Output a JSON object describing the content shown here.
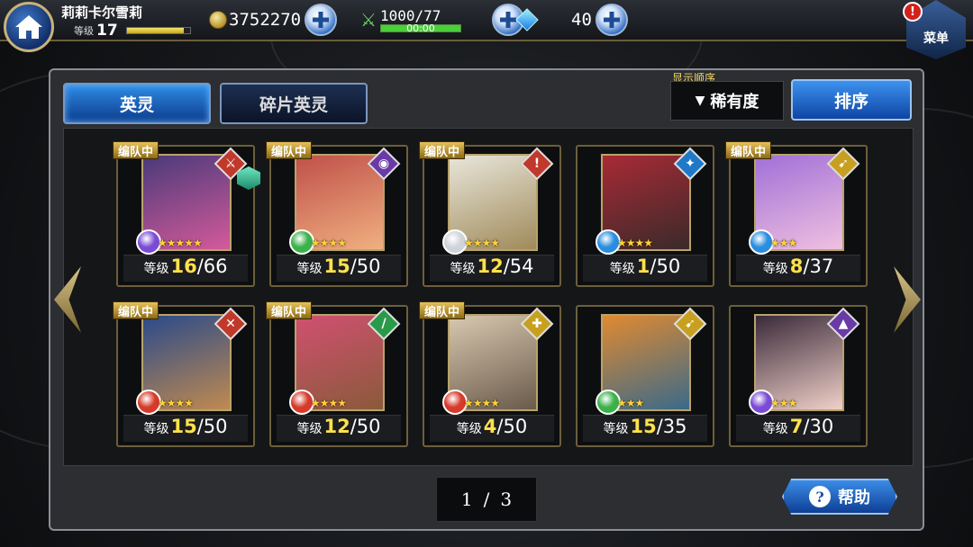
{
  "player": {
    "name": "莉莉卡尔雪莉",
    "level_label": "等级",
    "level": "17",
    "exp_fraction": 0.9
  },
  "resources": {
    "coins": "3752270",
    "stamina": "1000/77",
    "stamina_timer": "00:00",
    "stamina_fraction": 1.0,
    "gems": "40"
  },
  "menu": {
    "label": "菜单",
    "alert": "!"
  },
  "tabs": [
    {
      "label": "英灵"
    },
    {
      "label": "碎片英灵"
    }
  ],
  "sort": {
    "caption": "显示顺序",
    "selected": "稀有度",
    "button_label": "排序"
  },
  "cards": [
    {
      "badge": "编队中",
      "class_glyph": "⚔",
      "class_color": "#c0392b",
      "element_color": "#7b4bd6",
      "stars": 5,
      "level_label": "等级",
      "level": "16",
      "max_level": "66",
      "portrait_colors": [
        "#4a3a7a",
        "#d45a9a"
      ],
      "extra_icon": true
    },
    {
      "badge": "编队中",
      "class_glyph": "◉",
      "class_color": "#6a3aa6",
      "element_color": "#3bb14a",
      "stars": 4,
      "level_label": "等级",
      "level": "15",
      "max_level": "50",
      "portrait_colors": [
        "#c0504a",
        "#f0b080"
      ],
      "extra_icon": false
    },
    {
      "badge": "编队中",
      "class_glyph": "!",
      "class_color": "#c0392b",
      "element_color": "#cfd4da",
      "stars": 4,
      "level_label": "等级",
      "level": "12",
      "max_level": "54",
      "portrait_colors": [
        "#e8e6da",
        "#a08a5a"
      ],
      "extra_icon": false
    },
    {
      "badge": "",
      "class_glyph": "✦",
      "class_color": "#1f78c8",
      "element_color": "#2a8de0",
      "stars": 4,
      "level_label": "等级",
      "level": "1",
      "max_level": "50",
      "portrait_colors": [
        "#a82a35",
        "#3a2a2a"
      ],
      "extra_icon": false
    },
    {
      "badge": "编队中",
      "class_glyph": "➹",
      "class_color": "#c8a020",
      "element_color": "#2a8de0",
      "stars": 3,
      "level_label": "等级",
      "level": "8",
      "max_level": "37",
      "portrait_colors": [
        "#a070d8",
        "#f0c0e0"
      ],
      "extra_icon": false
    },
    {
      "badge": "编队中",
      "class_glyph": "✕",
      "class_color": "#c0392b",
      "element_color": "#d63a2a",
      "stars": 4,
      "level_label": "等级",
      "level": "15",
      "max_level": "50",
      "portrait_colors": [
        "#2a4a8a",
        "#c08a50"
      ],
      "extra_icon": false
    },
    {
      "badge": "编队中",
      "class_glyph": "/",
      "class_color": "#2a9a4a",
      "element_color": "#d63a2a",
      "stars": 4,
      "level_label": "等级",
      "level": "12",
      "max_level": "50",
      "portrait_colors": [
        "#d05070",
        "#8a5a3a"
      ],
      "extra_icon": false
    },
    {
      "badge": "编队中",
      "class_glyph": "✚",
      "class_color": "#c8a020",
      "element_color": "#d63a2a",
      "stars": 4,
      "level_label": "等级",
      "level": "4",
      "max_level": "50",
      "portrait_colors": [
        "#d8c8b0",
        "#6a5a4a"
      ],
      "extra_icon": false
    },
    {
      "badge": "",
      "class_glyph": "➹",
      "class_color": "#c8a020",
      "element_color": "#3bb14a",
      "stars": 3,
      "level_label": "等级",
      "level": "15",
      "max_level": "35",
      "portrait_colors": [
        "#e08a30",
        "#3a6a8a"
      ],
      "extra_icon": false
    },
    {
      "badge": "",
      "class_glyph": "▲",
      "class_color": "#6a3aa6",
      "element_color": "#7b4bd6",
      "stars": 3,
      "level_label": "等级",
      "level": "7",
      "max_level": "30",
      "portrait_colors": [
        "#3a2a3a",
        "#f0d0c8"
      ],
      "extra_icon": false
    }
  ],
  "pagination": {
    "current": "1",
    "separator": "/",
    "total": "3"
  },
  "help": {
    "icon": "?",
    "label": "帮助"
  }
}
